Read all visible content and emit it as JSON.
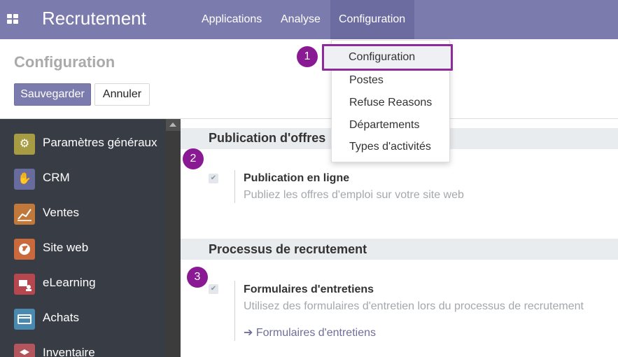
{
  "navbar": {
    "app_title": "Recrutement",
    "menu": [
      "Applications",
      "Analyse",
      "Configuration"
    ]
  },
  "control_panel": {
    "title": "Configuration",
    "save_label": "Sauvegarder",
    "cancel_label": "Annuler"
  },
  "dropdown": {
    "items": [
      "Configuration",
      "Postes",
      "Refuse Reasons",
      "Départements",
      "Types d'activités"
    ]
  },
  "sidebar": {
    "items": [
      {
        "label": "Paramètres généraux",
        "icon": "gear-icon",
        "color": "#a79c43"
      },
      {
        "label": "CRM",
        "icon": "handshake-icon",
        "color": "#676b9d"
      },
      {
        "label": "Ventes",
        "icon": "chart-icon",
        "color": "#c0783b"
      },
      {
        "label": "Site web",
        "icon": "globe-icon",
        "color": "#ca6a3c"
      },
      {
        "label": "eLearning",
        "icon": "elearning-icon",
        "color": "#b6474f"
      },
      {
        "label": "Achats",
        "icon": "card-icon",
        "color": "#4a8ab0"
      },
      {
        "label": "Inventaire",
        "icon": "box-icon",
        "color": "#b2555c"
      }
    ]
  },
  "sections": [
    {
      "title": "Publication d'offres",
      "setting": {
        "title": "Publication en ligne",
        "description": "Publiez les offres d'emploi sur votre site web"
      }
    },
    {
      "title": "Processus de recrutement",
      "setting": {
        "title": "Formulaires d'entretiens",
        "description": "Utilisez des formulaires d'entretien lors du processus de recrutement",
        "link": "Formulaires d'entretiens"
      }
    }
  ],
  "callouts": [
    "1",
    "2",
    "3"
  ],
  "colors": {
    "brand": "#7c7bad",
    "callout": "#8a1a94",
    "sidebar_bg": "#383c45"
  }
}
